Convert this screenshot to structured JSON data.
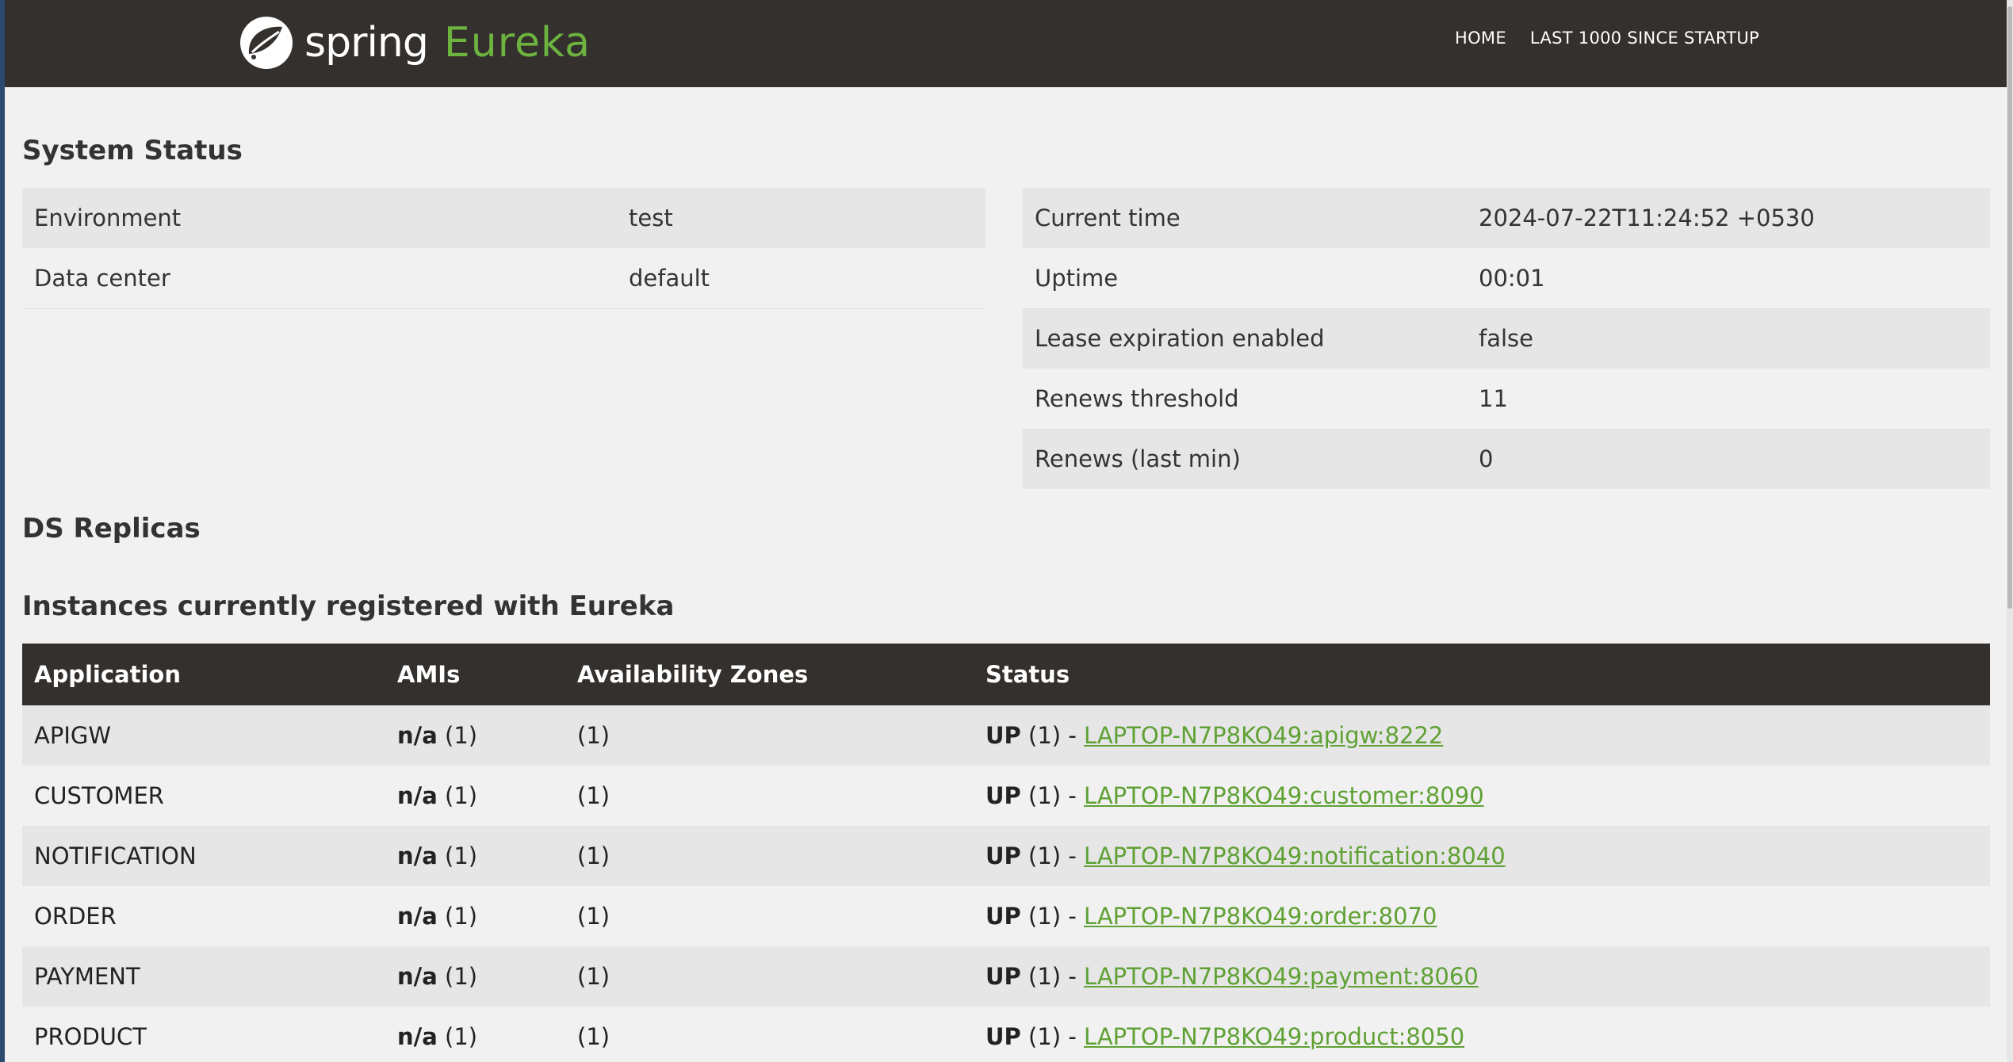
{
  "navbar": {
    "brand_spring": "spring",
    "brand_eureka": "Eureka",
    "links": [
      {
        "label": "HOME"
      },
      {
        "label": "LAST 1000 SINCE STARTUP"
      }
    ]
  },
  "system_status": {
    "title": "System Status",
    "left": [
      {
        "label": "Environment",
        "value": "test"
      },
      {
        "label": "Data center",
        "value": "default"
      }
    ],
    "right": [
      {
        "label": "Current time",
        "value": "2024-07-22T11:24:52 +0530"
      },
      {
        "label": "Uptime",
        "value": "00:01"
      },
      {
        "label": "Lease expiration enabled",
        "value": "false"
      },
      {
        "label": "Renews threshold",
        "value": "11"
      },
      {
        "label": "Renews (last min)",
        "value": "0"
      }
    ]
  },
  "ds_replicas": {
    "title": "DS Replicas"
  },
  "instances": {
    "title": "Instances currently registered with Eureka",
    "columns": [
      "Application",
      "AMIs",
      "Availability Zones",
      "Status"
    ],
    "rows": [
      {
        "app": "APIGW",
        "ami": "n/a",
        "ami_count": "(1)",
        "zones": "(1)",
        "status": "UP",
        "status_count": "(1) -",
        "link": "LAPTOP-N7P8KO49:apigw:8222"
      },
      {
        "app": "CUSTOMER",
        "ami": "n/a",
        "ami_count": "(1)",
        "zones": "(1)",
        "status": "UP",
        "status_count": "(1) -",
        "link": "LAPTOP-N7P8KO49:customer:8090"
      },
      {
        "app": "NOTIFICATION",
        "ami": "n/a",
        "ami_count": "(1)",
        "zones": "(1)",
        "status": "UP",
        "status_count": "(1) -",
        "link": "LAPTOP-N7P8KO49:notification:8040"
      },
      {
        "app": "ORDER",
        "ami": "n/a",
        "ami_count": "(1)",
        "zones": "(1)",
        "status": "UP",
        "status_count": "(1) -",
        "link": "LAPTOP-N7P8KO49:order:8070"
      },
      {
        "app": "PAYMENT",
        "ami": "n/a",
        "ami_count": "(1)",
        "zones": "(1)",
        "status": "UP",
        "status_count": "(1) -",
        "link": "LAPTOP-N7P8KO49:payment:8060"
      },
      {
        "app": "PRODUCT",
        "ami": "n/a",
        "ami_count": "(1)",
        "zones": "(1)",
        "status": "UP",
        "status_count": "(1) -",
        "link": "LAPTOP-N7P8KO49:product:8050"
      }
    ]
  },
  "colors": {
    "navbar_bg": "#34302d",
    "brand_green": "#6db33f",
    "link_green": "#5fa134",
    "page_bg": "#f1f1f1",
    "row_alt": "#e6e6e6"
  },
  "icons": {
    "logo": "spring-leaf-icon"
  }
}
